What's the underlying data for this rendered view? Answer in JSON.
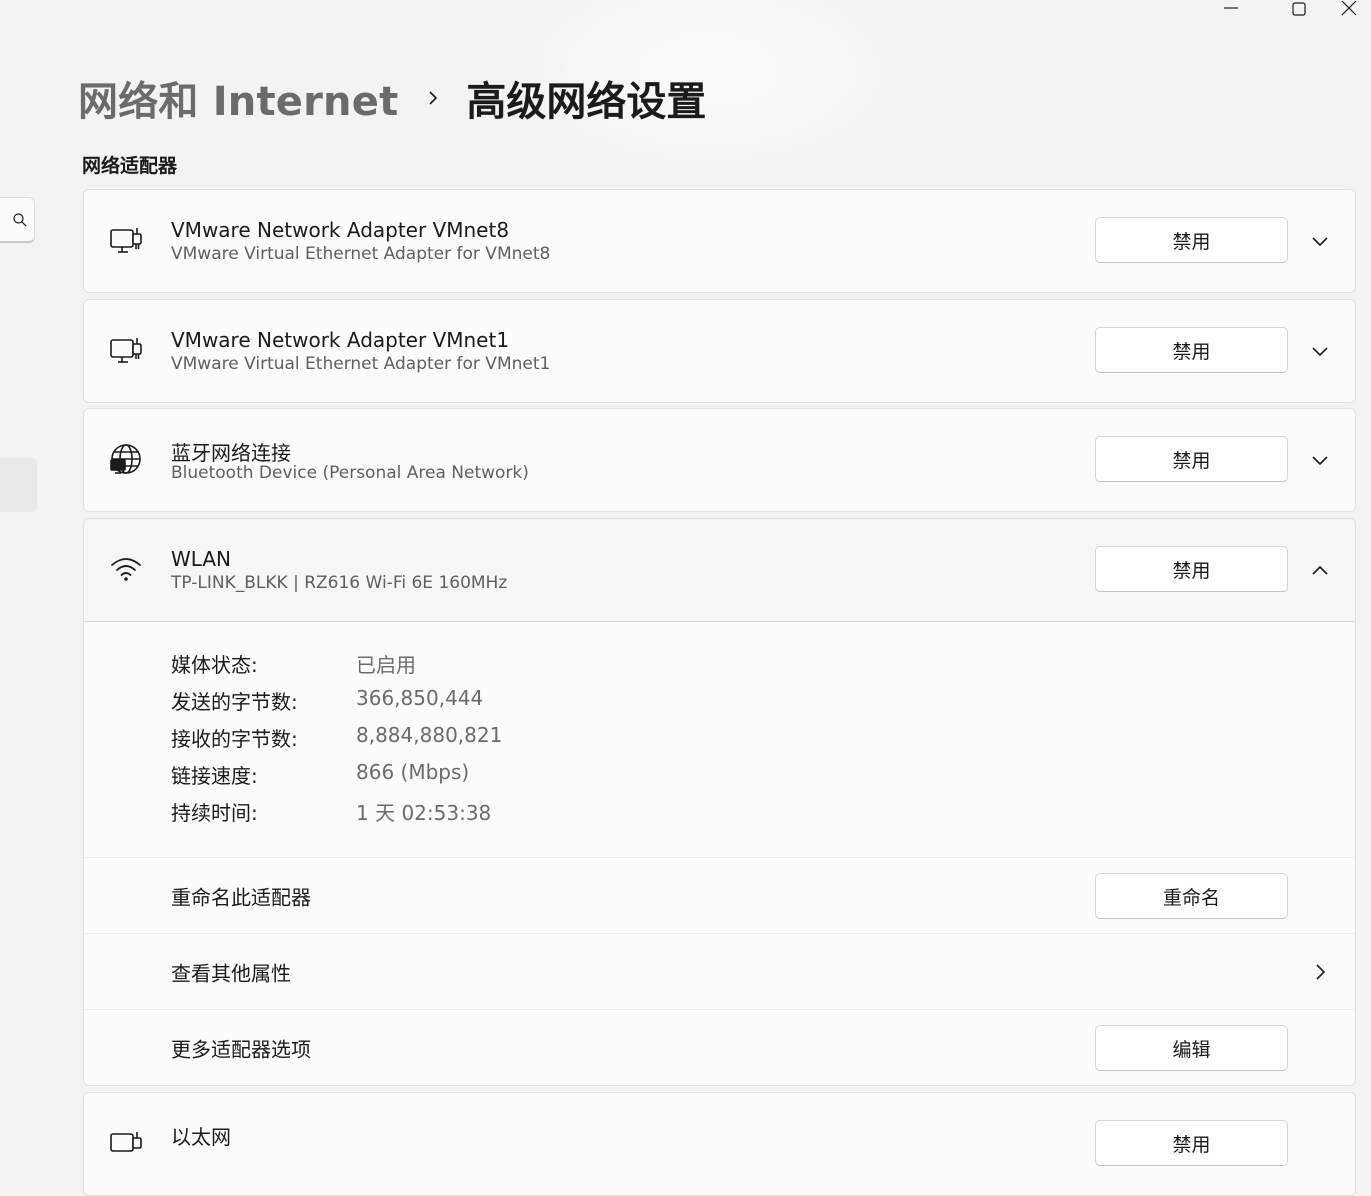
{
  "window": {
    "minimize_icon": "minimize-icon",
    "maximize_icon": "maximize-icon",
    "close_icon": "close-icon"
  },
  "breadcrumb": {
    "parent": "网络和 Internet",
    "separator_icon": "chevron-right-icon",
    "current": "高级网络设置"
  },
  "sidebar": {
    "search_icon": "search-icon"
  },
  "section": {
    "title": "网络适配器"
  },
  "adapters": [
    {
      "icon": "network-adapter-icon",
      "name": "VMware Network Adapter VMnet8",
      "description": "VMware Virtual Ethernet Adapter for VMnet8",
      "button": "禁用",
      "expanded": false
    },
    {
      "icon": "network-adapter-icon",
      "name": "VMware Network Adapter VMnet1",
      "description": "VMware Virtual Ethernet Adapter for VMnet1",
      "button": "禁用",
      "expanded": false
    },
    {
      "icon": "globe-network-icon",
      "name": "蓝牙网络连接",
      "description": "Bluetooth Device (Personal Area Network)",
      "button": "禁用",
      "expanded": false
    }
  ],
  "wlan": {
    "icon": "wifi-icon",
    "name": "WLAN",
    "description": "TP-LINK_BLKK | RZ616 Wi-Fi 6E 160MHz",
    "button": "禁用",
    "expanded": true,
    "details": [
      {
        "label": "媒体状态:",
        "value": "已启用"
      },
      {
        "label": "发送的字节数:",
        "value": "366,850,444"
      },
      {
        "label": "接收的字节数:",
        "value": "8,884,880,821"
      },
      {
        "label": "链接速度:",
        "value": "866 (Mbps)"
      },
      {
        "label": "持续时间:",
        "value": "1 天 02:53:38"
      }
    ],
    "rename": {
      "label": "重命名此适配器",
      "button": "重命名"
    },
    "properties": {
      "label": "查看其他属性"
    },
    "more_options": {
      "label": "更多适配器选项",
      "button": "编辑"
    }
  },
  "ethernet": {
    "icon": "network-adapter-icon",
    "name": "以太网",
    "button": "禁用"
  },
  "colors": {
    "background": "#f3f3f3",
    "card": "#fbfbfb",
    "border": "#e1e1e1",
    "secondary_text": "#6b6b6b"
  }
}
